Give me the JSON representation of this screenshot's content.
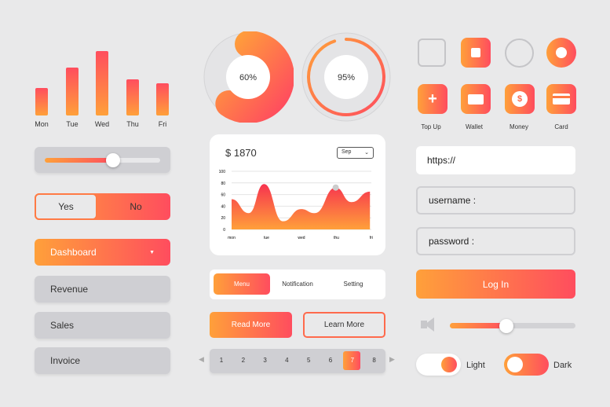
{
  "weekly": {
    "days": [
      "Mon",
      "Tue",
      "Wed",
      "Thu",
      "Fri"
    ],
    "levels": [
      0.43,
      0.74,
      1.0,
      0.56,
      0.5
    ]
  },
  "slider_left": {
    "value": 0.6
  },
  "toggle": {
    "yes": "Yes",
    "no": "No"
  },
  "menu": {
    "dashboard": "Dashboard",
    "items": [
      "Revenue",
      "Sales",
      "Invoice"
    ]
  },
  "donut1": {
    "label": "60%",
    "value": 60
  },
  "donut2": {
    "label": "95%",
    "value": 95
  },
  "card": {
    "amount": "$ 1870",
    "month": "Sep"
  },
  "chart_data": {
    "type": "area",
    "x_ticks": [
      "mon",
      "tue",
      "wed",
      "thu",
      "fri"
    ],
    "y_ticks": [
      "0",
      "20",
      "40",
      "60",
      "80",
      "100"
    ],
    "ylim": [
      0,
      100
    ],
    "grid": true,
    "points": [
      [
        0,
        52
      ],
      [
        0.49,
        28
      ],
      [
        0.93,
        78
      ],
      [
        1.47,
        14
      ],
      [
        1.99,
        35
      ],
      [
        2.38,
        28
      ],
      [
        2.98,
        72
      ],
      [
        3.43,
        47
      ],
      [
        3.96,
        65
      ]
    ]
  },
  "tabs": [
    "Menu",
    "Notification",
    "Setting"
  ],
  "buttons": {
    "read_more": "Read More",
    "learn_more": "Learn More",
    "login": "Log In"
  },
  "pagination": {
    "pages": [
      "1",
      "2",
      "3",
      "4",
      "5",
      "6",
      "7",
      "8"
    ],
    "active": "7"
  },
  "icons": [
    {
      "label": "Top Up",
      "icon": "plus"
    },
    {
      "label": "Wallet",
      "icon": "wallet"
    },
    {
      "label": "Money",
      "icon": "dollar"
    },
    {
      "label": "Card",
      "icon": "credit-card"
    }
  ],
  "fields": {
    "url": "https://",
    "username": "username :",
    "password": "password :"
  },
  "volume": {
    "value": 0.45
  },
  "theme": {
    "light": "Light",
    "dark": "Dark"
  },
  "colors": {
    "accent_start": "#ffa03a",
    "accent_end": "#ff4d5e"
  }
}
